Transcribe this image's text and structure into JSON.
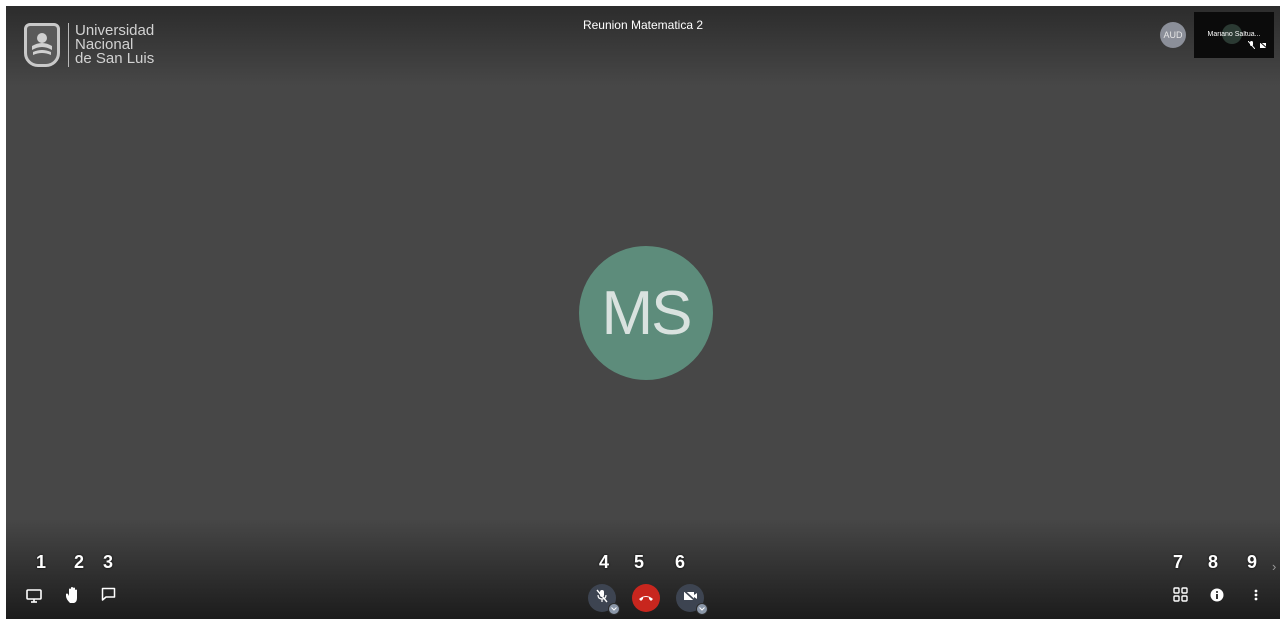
{
  "meeting": {
    "title": "Reunion Matematica 2"
  },
  "logo": {
    "icon": "university-crest-icon",
    "lines": [
      "Universidad",
      "Nacional",
      "de San Luis"
    ]
  },
  "participants": {
    "small_avatar_initials": "AUD",
    "thumbnail_name": "Mariano Saltua...",
    "main_speaker_initials": "MS"
  },
  "colors": {
    "stage_background": "#474747",
    "speaker_avatar": "#5d8c7b",
    "hangup_button": "#c8261e",
    "toolbar_button": "#3d4451"
  },
  "toolbar": {
    "left": [
      {
        "number": "1",
        "icon": "screen-share-icon"
      },
      {
        "number": "2",
        "icon": "raise-hand-icon"
      },
      {
        "number": "3",
        "icon": "chat-icon"
      }
    ],
    "center": [
      {
        "number": "4",
        "icon": "microphone-muted-icon"
      },
      {
        "number": "5",
        "icon": "hang-up-icon"
      },
      {
        "number": "6",
        "icon": "camera-off-icon"
      }
    ],
    "right": [
      {
        "number": "7",
        "icon": "tile-view-icon"
      },
      {
        "number": "8",
        "icon": "info-icon"
      },
      {
        "number": "9",
        "icon": "more-options-icon"
      }
    ]
  }
}
